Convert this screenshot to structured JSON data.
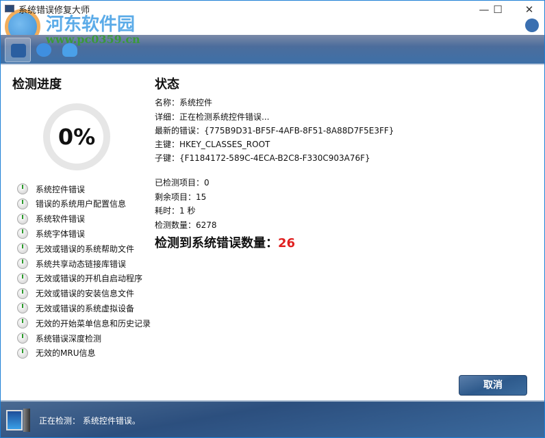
{
  "window": {
    "title": "系统错误修复大师",
    "minimize": "—",
    "maximize": "☐",
    "close": "✕"
  },
  "watermark": {
    "name": "河东软件园",
    "url": "www.pc0359.cn"
  },
  "progress": {
    "heading": "检测进度",
    "percent": "0%",
    "items": [
      "系统控件错误",
      "错误的系统用户配置信息",
      "系统软件错误",
      "系统字体错误",
      "无效或错误的系统帮助文件",
      "系统共享动态链接库错误",
      "无效或错误的开机自启动程序",
      "无效或错误的安装信息文件",
      "无效或错误的系统虚拟设备",
      "无效的开始菜单信息和历史记录",
      "系统错误深度检测",
      "无效的MRU信息"
    ]
  },
  "status": {
    "heading": "状态",
    "name": "名称：系统控件",
    "detail": "详细：正在检测系统控件错误...",
    "latest_error": "最新的错误：{775B9D31-BF5F-4AFB-8F51-8A88D7F5E3FF}",
    "main_key": "主键：HKEY_CLASSES_ROOT",
    "sub_key": "子键：{F1184172-589C-4ECA-B2C8-F330C903A76F}",
    "checked": "已检测项目：0",
    "remaining": "剩余项目：15",
    "elapsed": "耗时：1 秒",
    "count": "检测数量：6278",
    "found_label": "检测到系统错误数量：",
    "found_value": "26"
  },
  "cancel_label": "取消",
  "statusbar": {
    "text": "正在检测： 系统控件错误。"
  }
}
